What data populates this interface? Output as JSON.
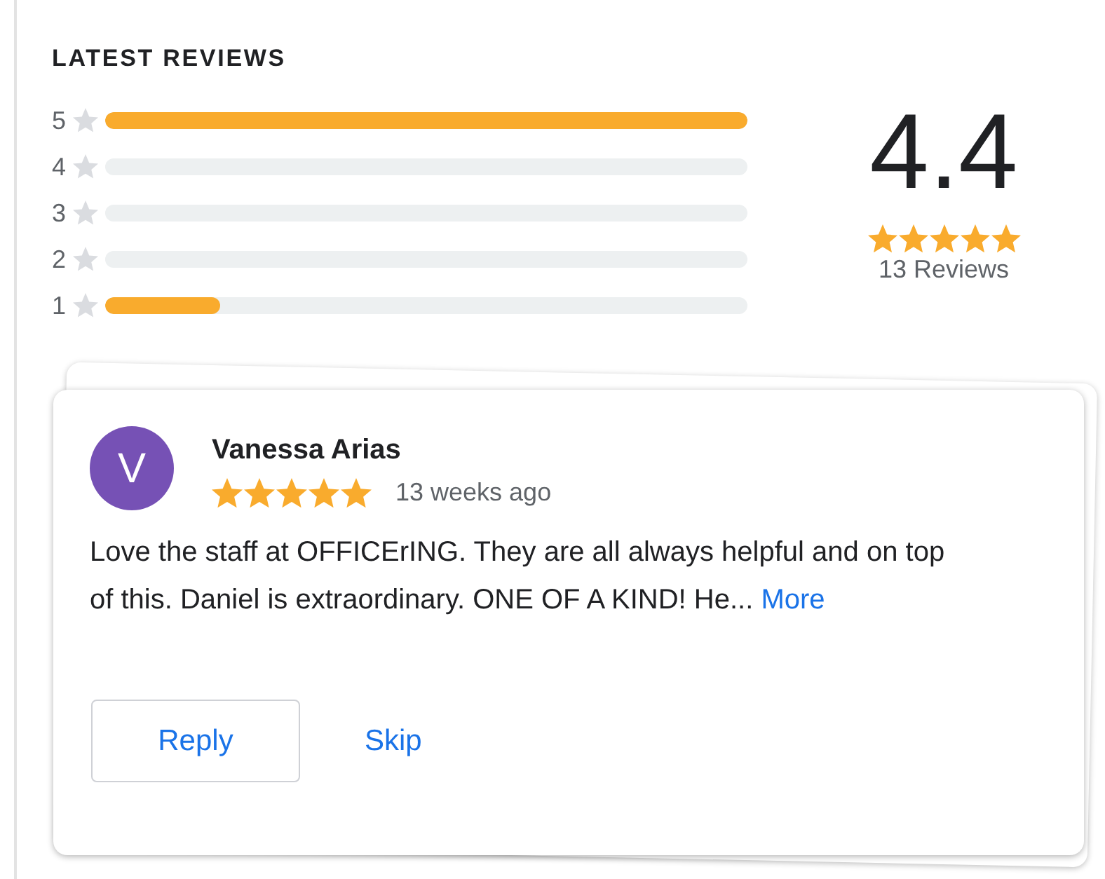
{
  "section_title": "LATEST REVIEWS",
  "distribution": [
    {
      "label": "5",
      "level": 1
    },
    {
      "label": "4",
      "level": 0
    },
    {
      "label": "3",
      "level": 0
    },
    {
      "label": "2",
      "level": 0
    },
    {
      "label": "1",
      "level": 0.18
    }
  ],
  "summary": {
    "average": "4.4",
    "stars": 5,
    "count": "13 Reviews"
  },
  "review": {
    "avatar_letter": "V",
    "author": "Vanessa Arias",
    "stars": 5,
    "time": "13 weeks ago",
    "text": "Love the staff at OFFICErING. They are all always helpful and on top of this. Daniel is extraordinary. ONE OF A KIND! He...",
    "more_link": "More",
    "buttons": [
      {
        "label": "Reply",
        "kind": "outlined"
      },
      {
        "label": "Skip",
        "kind": "text"
      }
    ]
  }
}
